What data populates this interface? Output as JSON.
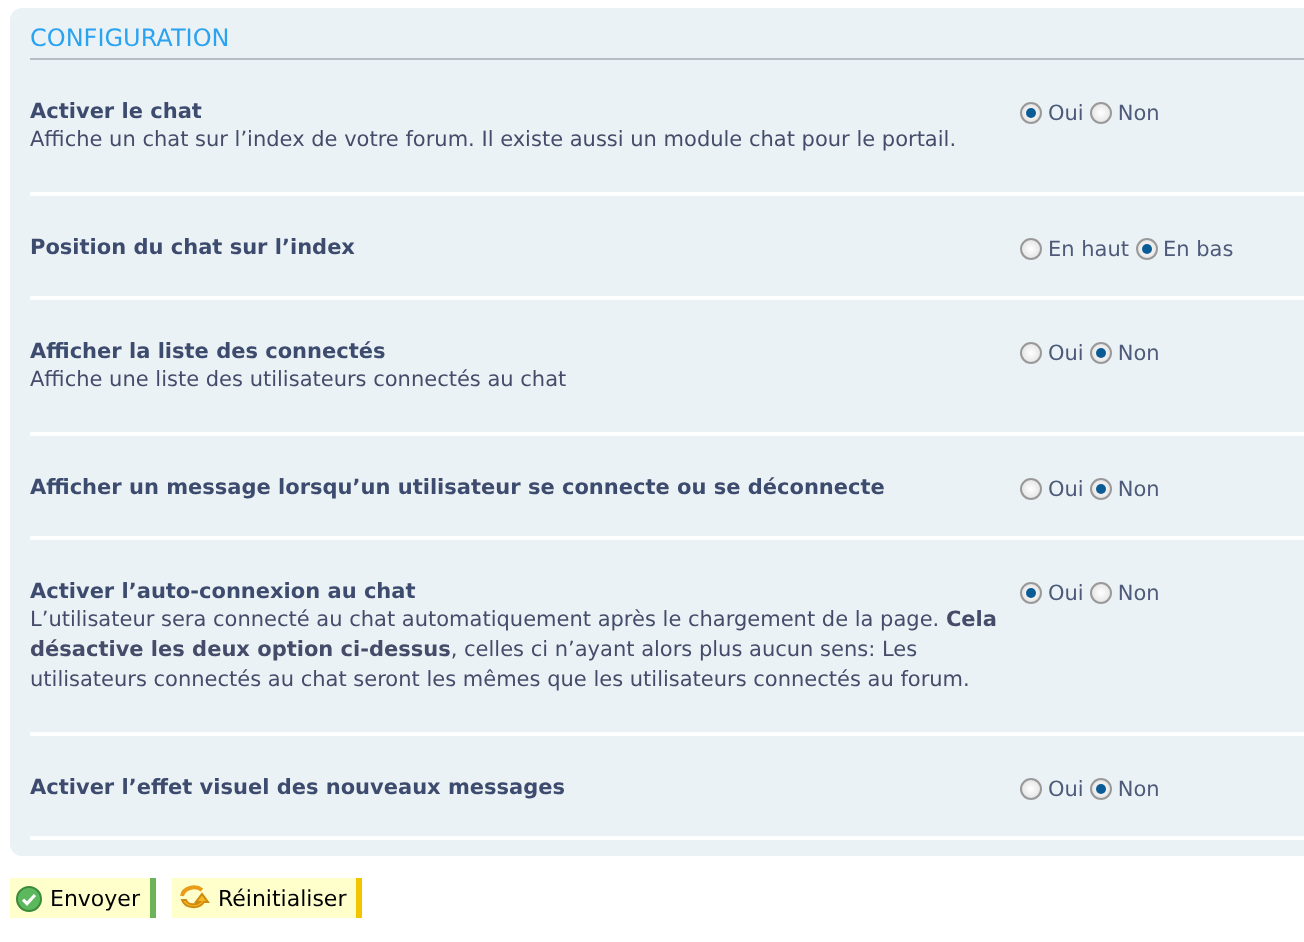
{
  "section": {
    "title": "CONFIGURATION"
  },
  "settings": [
    {
      "label": "Activer le chat",
      "description": "Affiche un chat sur l’index de votre forum. Il existe aussi un module chat pour le portail.",
      "options": [
        {
          "label": "Oui",
          "selected": true
        },
        {
          "label": "Non",
          "selected": false
        }
      ]
    },
    {
      "label": "Position du chat sur l’index",
      "options": [
        {
          "label": "En haut",
          "selected": false
        },
        {
          "label": "En bas",
          "selected": true
        }
      ]
    },
    {
      "label": "Afficher la liste des connectés",
      "description": "Affiche une liste des utilisateurs connectés au chat",
      "options": [
        {
          "label": "Oui",
          "selected": false
        },
        {
          "label": "Non",
          "selected": true
        }
      ]
    },
    {
      "label": "Afficher un message lorsqu’un utilisateur se connecte ou se déconnecte",
      "options": [
        {
          "label": "Oui",
          "selected": false
        },
        {
          "label": "Non",
          "selected": true
        }
      ]
    },
    {
      "label": "Activer l’auto-connexion au chat",
      "description": "L’utilisateur sera connecté au chat automatiquement après le chargement de la page. **Cela désactive les deux option ci-dessus**, celles ci n’ayant alors plus aucun sens: Les utilisateurs connectés au chat seront les mêmes que les utilisateurs connectés au forum.",
      "options": [
        {
          "label": "Oui",
          "selected": true
        },
        {
          "label": "Non",
          "selected": false
        }
      ]
    },
    {
      "label": "Activer l’effet visuel des nouveaux messages",
      "options": [
        {
          "label": "Oui",
          "selected": false
        },
        {
          "label": "Non",
          "selected": true
        }
      ]
    }
  ],
  "buttons": [
    {
      "kind": "submit",
      "label": "Envoyer"
    },
    {
      "kind": "reset",
      "label": "Réinitialiser"
    }
  ]
}
